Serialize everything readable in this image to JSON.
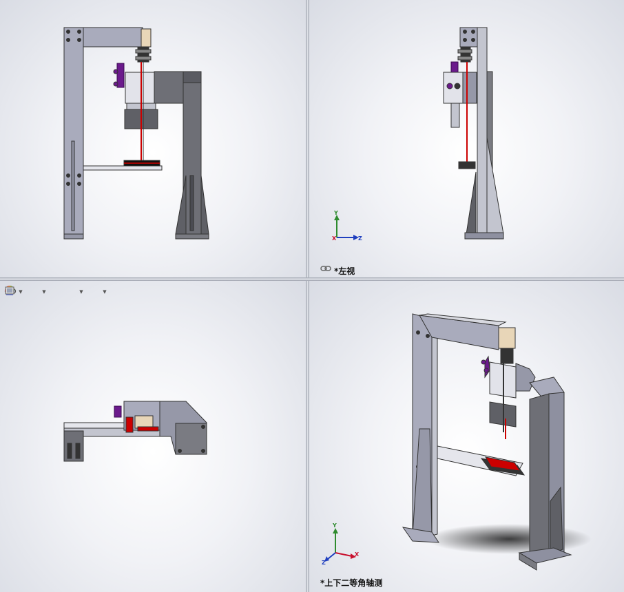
{
  "viewports": {
    "top_left": {
      "label": ""
    },
    "top_right": {
      "label": "*左视",
      "link_icon": "chain-link-icon"
    },
    "bottom_left": {
      "label": ""
    },
    "bottom_right": {
      "label": "*上下二等角轴测"
    }
  },
  "triad": {
    "axes": [
      "Y",
      "Z",
      "X"
    ]
  },
  "toolbar": {
    "items": [
      "view-orientation-icon",
      "hide-show-icon",
      "edit-appearance-icon",
      "apply-scene-icon",
      "view-settings-icon"
    ]
  },
  "colors": {
    "frame": "#a9abbc",
    "frame_dark": "#5f6066",
    "accent_red": "#cc0000",
    "accent_purple": "#6b1a8c",
    "axis_x": "#c8102e",
    "axis_y": "#2e8b2e",
    "axis_z": "#1f3fbf"
  }
}
